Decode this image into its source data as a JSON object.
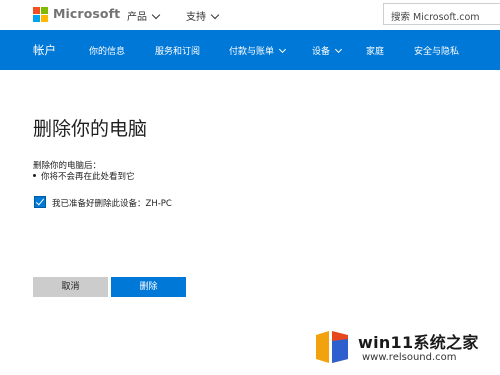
{
  "header": {
    "logo_text": "Microsoft",
    "logo_colors": [
      "#f25022",
      "#7fba00",
      "#00a4ef",
      "#ffb900"
    ],
    "nav": [
      {
        "label": "产品"
      },
      {
        "label": "支持"
      }
    ],
    "search_text": "搜索 Microsoft.com"
  },
  "account_nav": {
    "title": "帐户",
    "bar_color": "#0078d7",
    "items": [
      {
        "label": "你的信息"
      },
      {
        "label": "服务和订阅"
      },
      {
        "label": "付款与账单"
      },
      {
        "label": "设备"
      },
      {
        "label": "家庭"
      },
      {
        "label": "安全与隐私"
      }
    ]
  },
  "main": {
    "title": "删除你的电脑",
    "after_text": "删除你的电脑后：",
    "bullet": "你将不会再在此处看到它",
    "confirm_checked": true,
    "confirm_label": "我已准备好删除此设备：ZH-PC",
    "cancel_label": "取消",
    "delete_label": "删除"
  },
  "watermark": {
    "title": "win11系统之家",
    "url": "www.relsound.com"
  }
}
